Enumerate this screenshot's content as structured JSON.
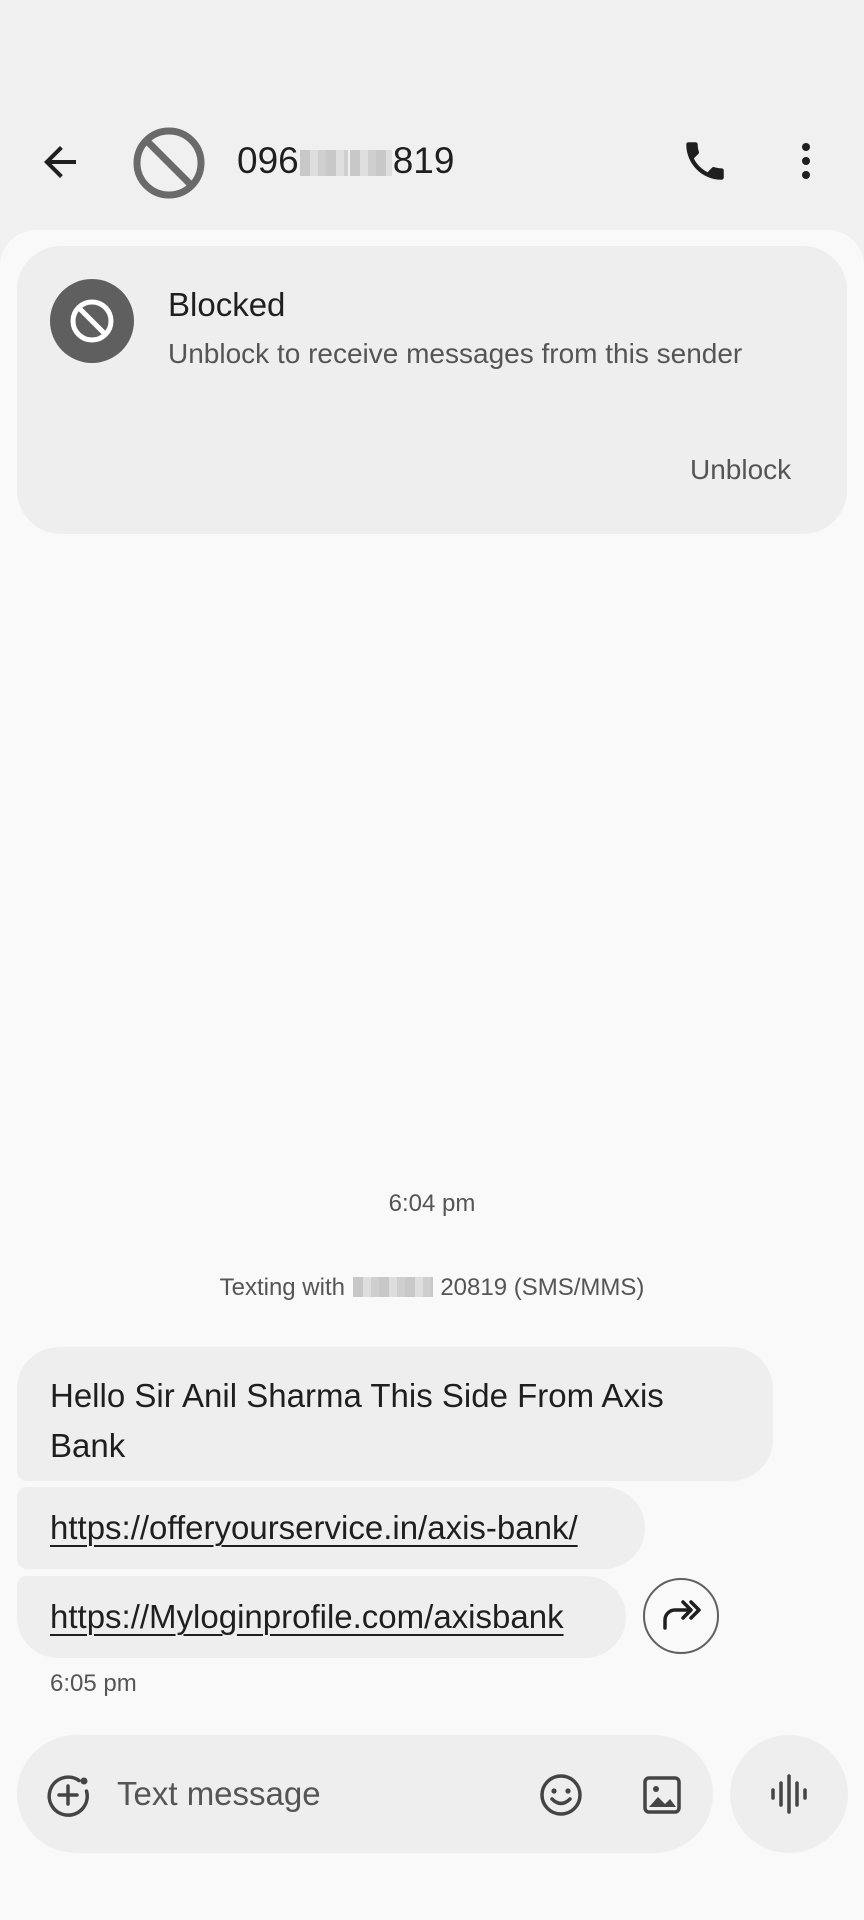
{
  "header": {
    "title_prefix": "096",
    "title_suffix": "819",
    "icons": {
      "back": "arrow-back-icon",
      "avatar": "blocked-icon",
      "call": "phone-icon",
      "more": "more-vert-icon"
    }
  },
  "blocked_card": {
    "title": "Blocked",
    "subtitle": "Unblock to receive messages from this sender",
    "action_label": "Unblock"
  },
  "conversation": {
    "timestamp_1": "6:04 pm",
    "texting_with_prefix": "Texting with",
    "texting_with_suffix": "20819 (SMS/MMS)",
    "messages": [
      {
        "text": "Hello Sir Anil Sharma This Side From Axis Bank"
      },
      {
        "text": "https://offeryourservice.in/axis-bank/"
      },
      {
        "text": "https://Myloginprofile.com/axisbank"
      }
    ],
    "timestamp_2": "6:05 pm"
  },
  "composer": {
    "placeholder": "Text message",
    "icons": {
      "add": "add-attachment-icon",
      "emoji": "emoji-icon",
      "gallery": "gallery-icon",
      "voice": "voice-waveform-icon"
    }
  },
  "colors": {
    "background": "#f0f0f0",
    "content": "#f9f9f9",
    "bubble": "#eeeeee",
    "text": "#1f1f1f",
    "secondary_text": "#555555",
    "blocked_icon": "#5f5f5f"
  }
}
